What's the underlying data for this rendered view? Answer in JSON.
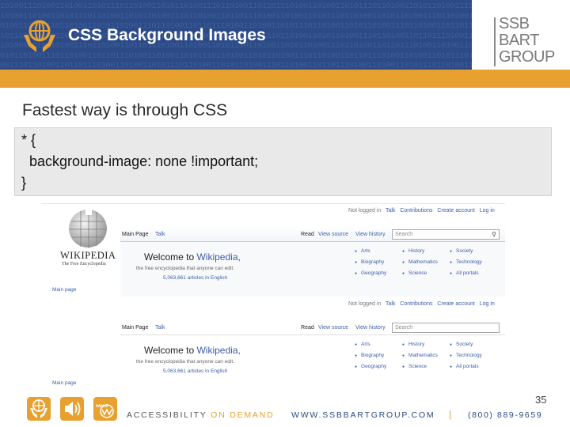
{
  "header": {
    "title": "CSS Background Images",
    "binary_pattern": "1010011101001101001101011101101001101011010011101101001101101110100110100110101110110100110101101001110110100110110111010011010011010111011010011010110100111011010011011011101001101001101011",
    "logo_lines": [
      "SSB",
      "BART",
      "GROUP"
    ]
  },
  "subtitle": "Fastest way is through CSS",
  "code": {
    "line1": "* {",
    "line2": "  background-image: none !important;",
    "line3": "}"
  },
  "wikipedia_screenshot": {
    "panels": [
      {
        "top_links": {
          "not_logged_in": "Not logged in",
          "talk": "Talk",
          "contributions": "Contributions",
          "create_account": "Create account",
          "log_in": "Log in"
        },
        "logo_name": "WIKIPEDIA",
        "logo_tagline": "The Free Encyclopedia",
        "tab_main": "Main Page",
        "tab_talk": "Talk",
        "tab_read": "Read",
        "tab_view_source": "View source",
        "tab_history": "View history",
        "search_placeholder": "Search",
        "welcome_prefix": "Welcome to ",
        "welcome_link": "Wikipedia,",
        "encyclopedia_line": "the free encyclopedia that anyone can edit.",
        "article_count": "5,063,661 articles in English",
        "portals": [
          "Arts",
          "History",
          "Society",
          "Biography",
          "Mathematics",
          "Technology",
          "Geography",
          "Science",
          "All portals"
        ],
        "sidebar_main_page": "Main page"
      },
      {
        "top_links": {
          "not_logged_in": "Not logged in",
          "talk": "Talk",
          "contributions": "Contributions",
          "create_account": "Create account",
          "log_in": "Log in"
        },
        "tab_main": "Main Page",
        "tab_talk": "Talk",
        "tab_read": "Read",
        "tab_view_source": "View source",
        "tab_history": "View history",
        "search_placeholder": "Search",
        "welcome_prefix": "Welcome to ",
        "welcome_link": "Wikipedia,",
        "encyclopedia_line": "the free encyclopedia that anyone can edit.",
        "article_count": "5,063,661 articles in English",
        "portals": [
          "Arts",
          "History",
          "Society",
          "Biography",
          "Mathematics",
          "Technology",
          "Geography",
          "Science",
          "All portals"
        ],
        "sidebar_main_page": "Main page"
      }
    ]
  },
  "page_number": "35",
  "footer": {
    "accessibility": "ACCESSIBILITY",
    "on_demand": "ON DEMAND",
    "url": "WWW.SSBBARTGROUP.COM",
    "separator": "|",
    "phone": "(800) 889-9659",
    "icons": [
      "hands-globe-icon",
      "speaker-icon",
      "www-icon"
    ]
  },
  "colors": {
    "header_blue": "#2b4a86",
    "accent_gold": "#e8a12f",
    "code_bg": "#e9e9e9",
    "link_blue": "#3b5ea8"
  }
}
